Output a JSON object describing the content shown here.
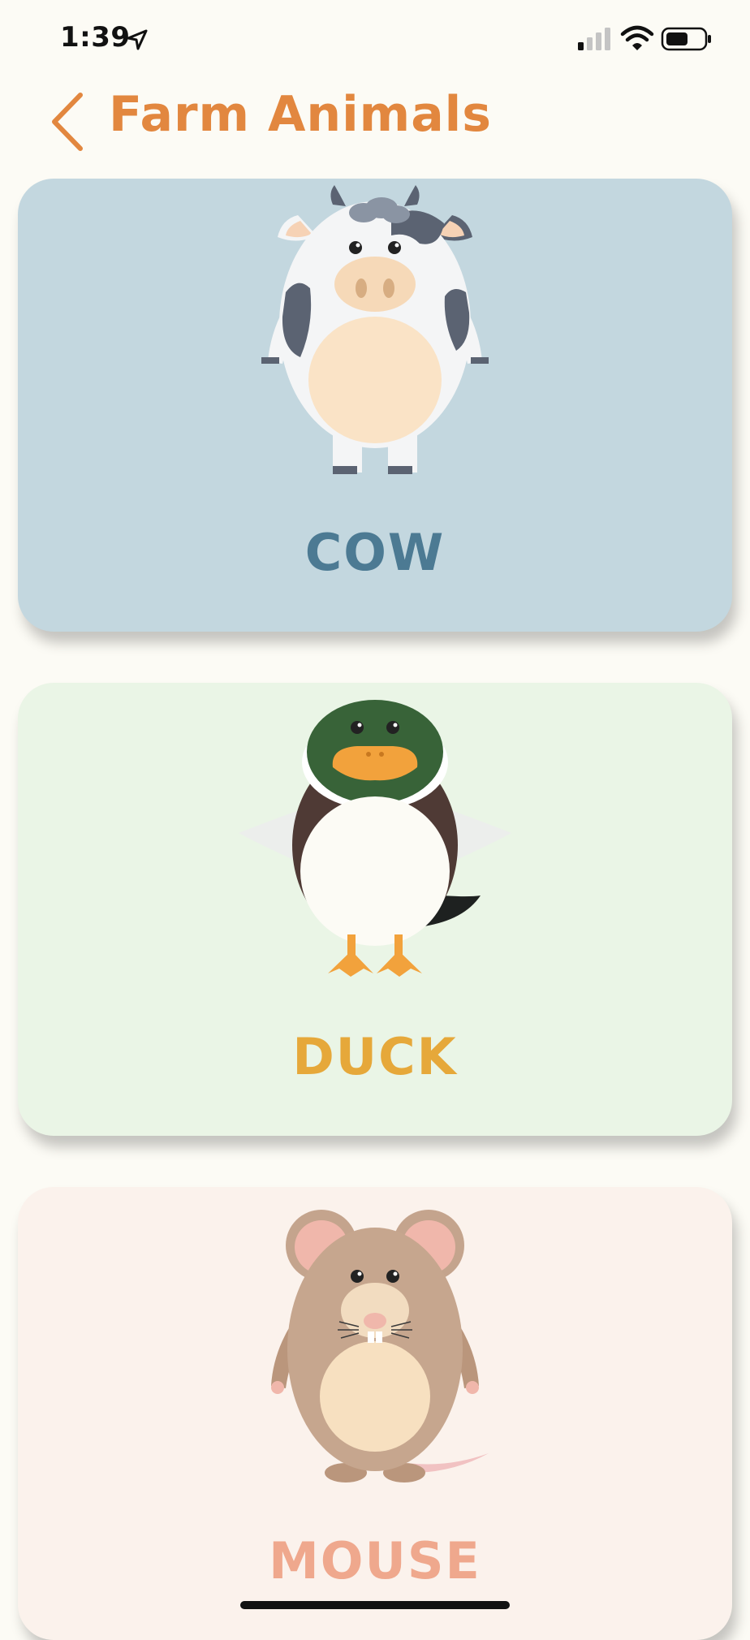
{
  "status": {
    "time": "1:39",
    "icons": [
      "location-arrow-icon",
      "cellular-signal-icon",
      "wifi-icon",
      "battery-icon"
    ]
  },
  "nav": {
    "title": "Farm Animals",
    "back_icon": "chevron-left-icon"
  },
  "colors": {
    "background": "#fcfbf5",
    "title": "#e2873f"
  },
  "cards": [
    {
      "label": "COW",
      "background": "#c3d7df",
      "label_color": "#4c7a93",
      "icon": "cow-illustration"
    },
    {
      "label": "DUCK",
      "background": "#eaf5e6",
      "label_color": "#e6a83a",
      "icon": "duck-illustration"
    },
    {
      "label": "MOUSE",
      "background": "#fbf2ec",
      "label_color": "#efa88d",
      "icon": "mouse-illustration"
    }
  ]
}
